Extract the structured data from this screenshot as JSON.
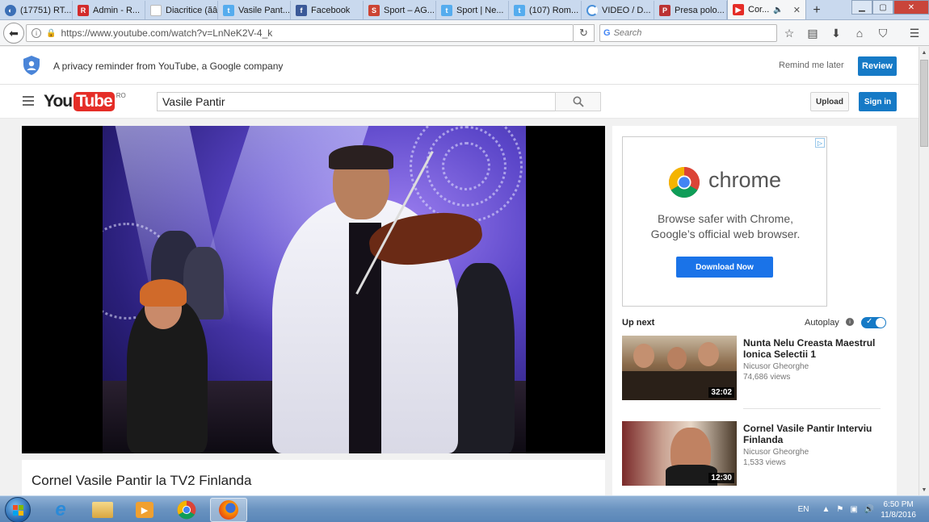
{
  "browser": {
    "tabs": [
      {
        "label": "(17751) RT...",
        "icon": "globe-icon",
        "color": "#3b6fb6"
      },
      {
        "label": "Admin - R...",
        "icon": "r-logo-icon",
        "color": "#d22b2b"
      },
      {
        "label": "Diacritice (ăâîş...",
        "icon": "blank-page-icon",
        "color": "#dddddd"
      },
      {
        "label": "Vasile Pant...",
        "icon": "twitter-icon",
        "color": "#55acee"
      },
      {
        "label": "Facebook",
        "icon": "facebook-icon",
        "color": "#3b5998"
      },
      {
        "label": "Sport – AG...",
        "icon": "sport-icon",
        "color": "#c43"
      },
      {
        "label": "Sport | Ne...",
        "icon": "twitter-icon",
        "color": "#55acee"
      },
      {
        "label": "(107) Rom...",
        "icon": "twitter-icon",
        "color": "#55acee"
      },
      {
        "label": "VIDEO / D...",
        "icon": "loading-icon",
        "color": "#4a90d9"
      },
      {
        "label": "Presa polo...",
        "icon": "news-icon",
        "color": "#b33"
      },
      {
        "label": "Cor...",
        "icon": "youtube-icon",
        "color": "#e52d27",
        "active": true
      }
    ],
    "url": "https://www.youtube.com/watch?v=LnNeK2V-4_k",
    "search_placeholder": "Search"
  },
  "privacy": {
    "text": "A privacy reminder from YouTube, a Google company",
    "remind_label": "Remind me later",
    "review_label": "Review"
  },
  "header": {
    "logo_you": "You",
    "logo_tube": "Tube",
    "logo_region": "RO",
    "search_value": "Vasile Pantir",
    "upload_label": "Upload",
    "signin_label": "Sign in"
  },
  "video": {
    "title": "Cornel Vasile Pantir la TV2 Finlanda"
  },
  "ad": {
    "brand": "chrome",
    "line1": "Browse safer with Chrome,",
    "line2": "Google’s official web browser.",
    "button_label": "Download Now"
  },
  "sidebar": {
    "upnext_label": "Up next",
    "autoplay_label": "Autoplay",
    "items": [
      {
        "title": "Nunta Nelu Creasta Maestrul Ionica Selectii 1",
        "channel": "Nicusor Gheorghe",
        "views": "74,686 views",
        "duration": "32:02"
      },
      {
        "title": "Cornel Vasile Pantir Interviu Finlanda",
        "channel": "Nicusor Gheorghe",
        "views": "1,533 views",
        "duration": "12:30"
      }
    ]
  },
  "taskbar": {
    "language": "EN",
    "time": "6:50 PM",
    "date": "11/8/2016"
  },
  "colors": {
    "yt_red": "#e52d27",
    "yt_blue": "#167ac6",
    "chrome_blue": "#1a73e8"
  }
}
